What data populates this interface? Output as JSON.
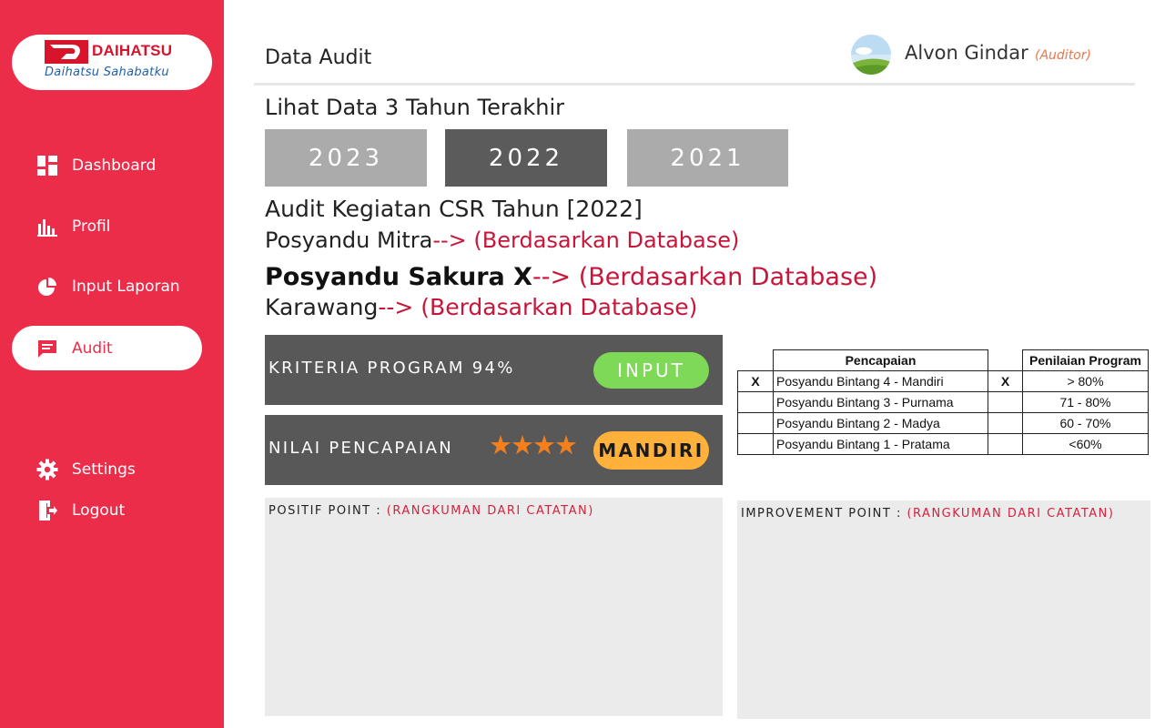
{
  "brand": {
    "name": "DAIHATSU",
    "tagline": "Daihatsu Sahabatku"
  },
  "sidebar": {
    "items": [
      {
        "label": "Dashboard",
        "icon": "dashboard-icon"
      },
      {
        "label": "Profil",
        "icon": "bar-chart-icon"
      },
      {
        "label": "Input Laporan",
        "icon": "pie-chart-icon"
      },
      {
        "label": "Audit",
        "icon": "chat-icon",
        "active": true
      }
    ],
    "bottom_items": [
      {
        "label": "Settings",
        "icon": "gear-icon"
      },
      {
        "label": "Logout",
        "icon": "logout-icon"
      }
    ]
  },
  "header": {
    "title": "Data Audit",
    "user_name": "Alvon Gindar",
    "user_role": "(Auditor)"
  },
  "years_section": {
    "heading": "Lihat Data 3 Tahun Terakhir",
    "tabs": [
      "2023",
      "2022",
      "2021"
    ],
    "active_tab": "2022"
  },
  "audit_info": {
    "title": "Audit Kegiatan CSR Tahun [2022]",
    "mitra_label": "Posyandu  Mitra",
    "name_label": "Posyandu  Sakura X",
    "location_label": "Karawang",
    "arrow": "--> ",
    "source_note": "(Berdasarkan Database)"
  },
  "criteria": {
    "label": "KRITERIA PROGRAM  94%",
    "button": "INPUT"
  },
  "achievement": {
    "label": "NILAI PENCAPAIAN",
    "stars": 4,
    "badge": "MANDIRI",
    "colors": {
      "star": "#f77f1b",
      "badge": "#ffb13b",
      "input": "#7ed957"
    }
  },
  "table": {
    "headers": {
      "pencapaian": "Pencapaian",
      "penilaian": "Penilaian Program"
    },
    "rows": [
      {
        "mark": "X",
        "name": "Posyandu Bintang 4 - Mandiri",
        "mark2": "X",
        "score": "> 80%"
      },
      {
        "mark": "",
        "name": "Posyandu Bintang 3 - Purnama",
        "mark2": "",
        "score": "71 - 80%"
      },
      {
        "mark": "",
        "name": "Posyandu Bintang 2 - Madya",
        "mark2": "",
        "score": "60 - 70%"
      },
      {
        "mark": "",
        "name": "Posyandu Bintang 1 - Pratama",
        "mark2": "",
        "score": "<60%"
      }
    ]
  },
  "notes": {
    "positive_label": "POSITIF POINT : ",
    "positive_hint": "(RANGKUMAN DARI CATATAN)",
    "improvement_label": "IMPROVEMENT POINT :  ",
    "improvement_hint": "(RANGKUMAN DARI CATATAN)"
  },
  "theme": {
    "sidebar": "#ec2d4a",
    "accent_red": "#c8163a"
  }
}
